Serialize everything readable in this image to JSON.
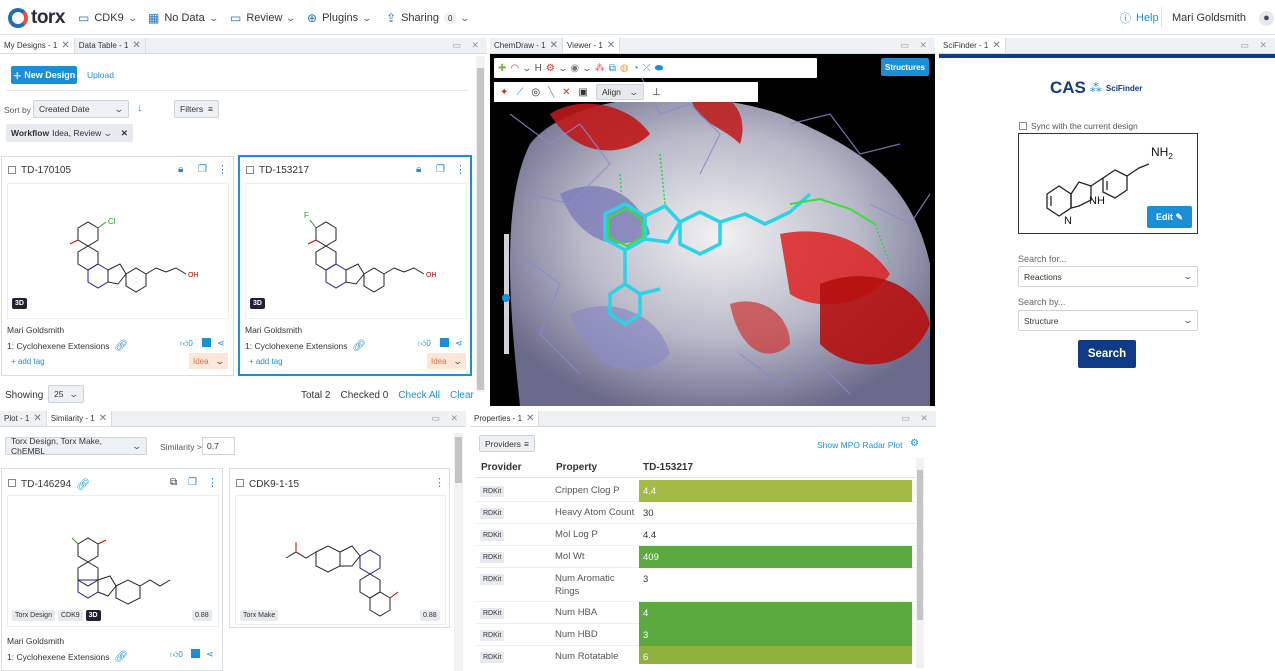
{
  "topbar": {
    "logo": "torx",
    "project": "CDK9",
    "data": "No Data",
    "review": "Review",
    "plugins": "Plugins",
    "sharing": "Sharing",
    "sharing_count": "0",
    "help": "Help",
    "user": "Mari Goldsmith"
  },
  "designs_panel": {
    "tabs": [
      "My Designs - 1",
      "Data Table - 1"
    ],
    "new_design": "New Design",
    "upload": "Upload",
    "sort_label": "Sort by",
    "sort_value": "Created Date",
    "filters": "Filters",
    "filter_chip_label": "Workflow",
    "filter_chip_value": "Idea, Review",
    "cards": [
      {
        "id": "TD-170105",
        "author": "Mari Goldsmith",
        "series": "1: Cyclohexene Extensions",
        "likes": "0",
        "add_tag": "+ add tag",
        "status": "Idea",
        "badge": "3D",
        "halogen": "Cl",
        "acid": "OH"
      },
      {
        "id": "TD-153217",
        "author": "Mari Goldsmith",
        "series": "1: Cyclohexene Extensions",
        "likes": "0",
        "add_tag": "+ add tag",
        "status": "Idea",
        "badge": "3D",
        "halogen": "F",
        "acid": "OH"
      }
    ],
    "showing_label": "Showing",
    "showing_value": "25",
    "total": "Total 2",
    "checked": "Checked 0",
    "check_all": "Check All",
    "clear": "Clear"
  },
  "viewer_panel": {
    "tabs": [
      "ChemDraw - 1",
      "Viewer - 1"
    ],
    "structures_button": "Structures",
    "align_label": "Align"
  },
  "scifinder_panel": {
    "tab": "SciFinder - 1",
    "logo_cas": "CAS",
    "logo_sf": "SciFinder",
    "sync_label": "Sync with the current design",
    "nh2": "NH",
    "nh2_sub": "2",
    "nh": "NH",
    "n": "N",
    "edit": "Edit",
    "search_for_label": "Search for...",
    "search_for_value": "Reactions",
    "search_by_label": "Search by...",
    "search_by_value": "Structure",
    "search_button": "Search"
  },
  "similarity_panel": {
    "tabs": [
      "Plot - 1",
      "Similarity - 1"
    ],
    "source_select": "Torx Design, Torx Make, ChEMBL",
    "similarity_label": "Similarity >",
    "similarity_value": "0.7",
    "cards": [
      {
        "id": "TD-146294",
        "tags": [
          "Torx Design",
          "CDK9",
          "3D"
        ],
        "score": "0.88",
        "author": "Mari Goldsmith",
        "series": "1: Cyclohexene Extensions",
        "likes": "0"
      },
      {
        "id": "CDK9-1-15",
        "tags": [
          "Torx Make"
        ],
        "score": "0.88"
      }
    ]
  },
  "properties_panel": {
    "tab": "Properties - 1",
    "providers": "Providers",
    "mpo_link": "Show MPO Radar Plot",
    "headers": [
      "Provider",
      "Property",
      "TD-153217"
    ],
    "rows": [
      {
        "provider": "RDKit",
        "property": "Crippen Clog P",
        "value": "4.4",
        "color": "#a3bb44"
      },
      {
        "provider": "RDKit",
        "property": "Heavy Atom Count",
        "value": "30",
        "color": ""
      },
      {
        "provider": "RDKit",
        "property": "Mol Log P",
        "value": "4.4",
        "color": ""
      },
      {
        "provider": "RDKit",
        "property": "Mol Wt",
        "value": "409",
        "color": "#5aaa3f"
      },
      {
        "provider": "RDKit",
        "property": "Num Aromatic Rings",
        "value": "3",
        "color": ""
      },
      {
        "provider": "RDKit",
        "property": "Num HBA",
        "value": "4",
        "color": "#5aaa3f"
      },
      {
        "provider": "RDKit",
        "property": "Num HBD",
        "value": "3",
        "color": "#5aaa3f"
      },
      {
        "provider": "RDKit",
        "property": "Num Rotatable",
        "value": "6",
        "color": "#8fb23f"
      }
    ]
  },
  "colors": {
    "accent": "#1a8fd8",
    "navy": "#0f3a85",
    "green": "#5aaa3f",
    "olive": "#a3bb44"
  }
}
